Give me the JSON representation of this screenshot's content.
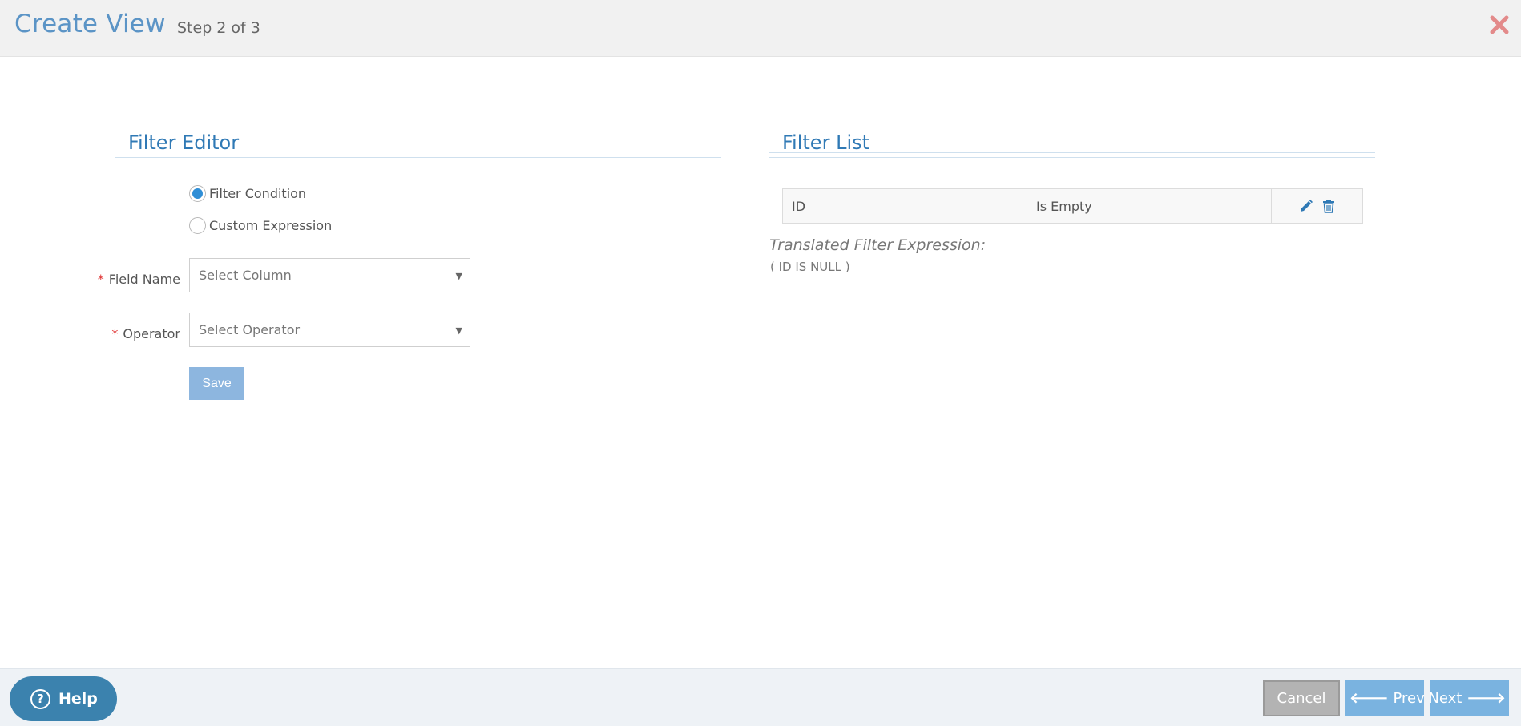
{
  "header": {
    "title": "Create View",
    "step": "Step 2 of 3",
    "close_icon": "close-icon",
    "close_color": "#e38a8a"
  },
  "filter_editor": {
    "title": "Filter Editor",
    "radio_options": [
      {
        "label": "Filter Condition",
        "selected": true
      },
      {
        "label": "Custom Expression",
        "selected": false
      }
    ],
    "field_name": {
      "label": "Field Name",
      "required": "*",
      "placeholder": "Select Column"
    },
    "operator": {
      "label": "Operator",
      "required": "*",
      "placeholder": "Select Operator"
    },
    "save_label": "Save"
  },
  "filter_list": {
    "title": "Filter List",
    "rows": [
      {
        "field": "ID",
        "operator": "Is Empty",
        "actions": [
          "pencil-icon",
          "trash-icon"
        ]
      }
    ],
    "translated_label": "Translated Filter Expression:",
    "translated_value": "( ID IS NULL )"
  },
  "footer": {
    "help_label": "Help",
    "cancel_label": "Cancel",
    "prev_label": "Prev",
    "next_label": "Next"
  },
  "colors": {
    "accent": "#2f79b5",
    "primary_button": "#7ab3e0",
    "help_button": "#3b82ae",
    "required": "#e03535"
  }
}
